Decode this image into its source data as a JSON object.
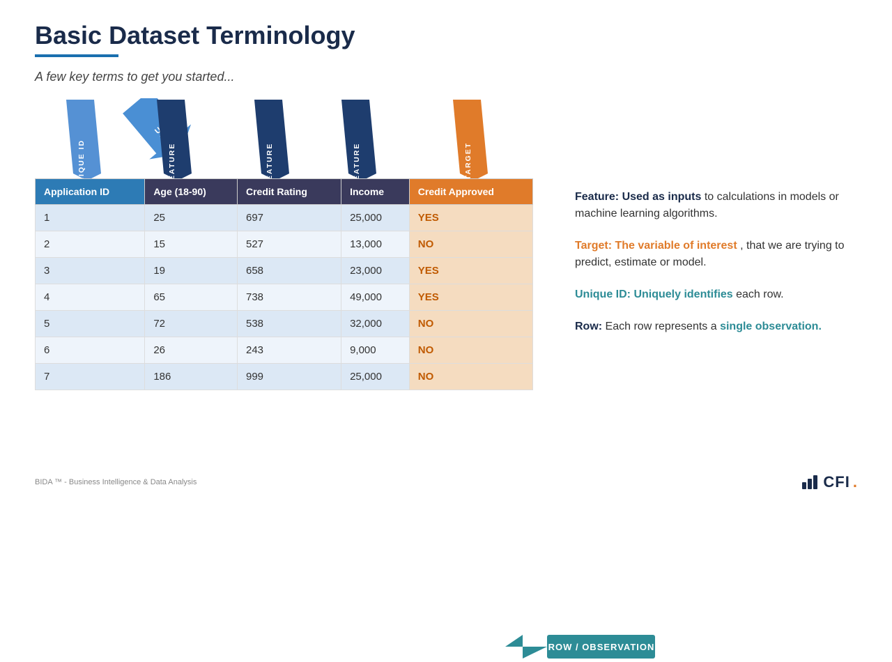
{
  "slide": {
    "title": "Basic Dataset Terminology",
    "subtitle": "A few key terms to get you started...",
    "arrows": [
      {
        "label": "UNIQUE ID",
        "type": "blue-light",
        "col_index": 0
      },
      {
        "label": "FEATURE",
        "type": "blue-dark",
        "col_index": 1
      },
      {
        "label": "FEATURE",
        "type": "blue-dark",
        "col_index": 2
      },
      {
        "label": "FEATURE",
        "type": "blue-dark",
        "col_index": 3
      },
      {
        "label": "TARGET",
        "type": "orange",
        "col_index": 4
      }
    ],
    "table": {
      "headers": [
        "Application ID",
        "Age (18-90)",
        "Credit Rating",
        "Income",
        "Credit Approved"
      ],
      "rows": [
        [
          "1",
          "25",
          "697",
          "25,000",
          "YES"
        ],
        [
          "2",
          "15",
          "527",
          "13,000",
          "NO"
        ],
        [
          "3",
          "19",
          "658",
          "23,000",
          "YES"
        ],
        [
          "4",
          "65",
          "738",
          "49,000",
          "YES"
        ],
        [
          "5",
          "72",
          "538",
          "32,000",
          "NO"
        ],
        [
          "6",
          "26",
          "243",
          "9,000",
          "NO"
        ],
        [
          "7",
          "186",
          "999",
          "25,000",
          "NO"
        ]
      ]
    },
    "row_obs_label": "ROW / OBSERVATION",
    "definitions": [
      {
        "bold_part": "Feature: Used as inputs",
        "rest": " to calculations in models or machine learning algorithms.",
        "bold_color": "dark"
      },
      {
        "bold_part": "Target: The variable of interest",
        "rest": ", that we are trying to predict, estimate or model.",
        "bold_color": "orange"
      },
      {
        "bold_part": "Unique ID: Uniquely identifies",
        "rest": " each row.",
        "bold_color": "teal"
      },
      {
        "bold_part": "Row:",
        "rest_part1": " Each row represents a ",
        "highlight": "single observation.",
        "bold_color": "normal",
        "highlight_color": "teal"
      }
    ],
    "footer": {
      "left": "BIDA ™ - Business Intelligence & Data Analysis",
      "logo_text": "CFI",
      "logo_dot": "."
    }
  }
}
